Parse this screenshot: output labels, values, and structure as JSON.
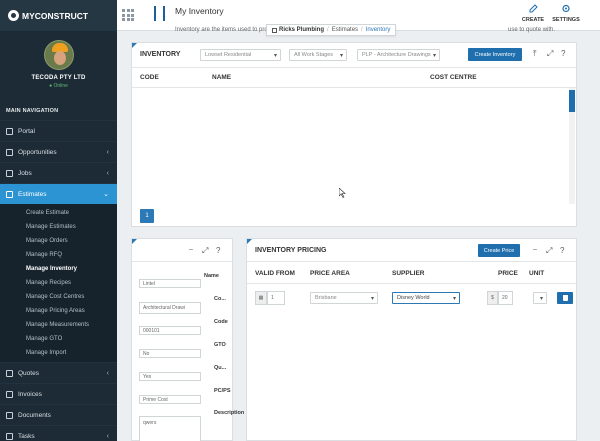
{
  "app": {
    "brand": "MYCONSTRUCT"
  },
  "profile": {
    "company": "TECODA PTY LTD",
    "status": "Online"
  },
  "nav": {
    "heading": "MAIN NAVIGATION",
    "items": [
      {
        "label": "Portal",
        "has_children": false
      },
      {
        "label": "Opportunities",
        "has_children": true
      },
      {
        "label": "Jobs",
        "has_children": true
      },
      {
        "label": "Estimates",
        "has_children": true,
        "active": true
      }
    ],
    "estimates_sub": [
      "Create Estimate",
      "Manage Estimates",
      "Manage Orders",
      "Manage RFQ",
      "Manage Inventory",
      "Manage Recipes",
      "Manage Cost Centres",
      "Manage Pricing Areas",
      "Manage Measurements",
      "Manage GTO",
      "Manage Import"
    ],
    "current_sub": "Manage Inventory",
    "items_after": [
      {
        "label": "Quotes",
        "has_children": true
      },
      {
        "label": "Invoices",
        "has_children": false
      },
      {
        "label": "Documents",
        "has_children": false
      },
      {
        "label": "Tasks",
        "has_children": true
      }
    ]
  },
  "header": {
    "title": "My Inventory",
    "description": "Inventory are the items used to produce your quotes and estimates, th",
    "description_tail": "use to quote with.",
    "breadcrumb": [
      "Ricks Plumbing",
      "Estimates",
      "Inventory"
    ],
    "create_label": "CREATE",
    "settings_label": "SETTINGS"
  },
  "inventory": {
    "title": "INVENTORY",
    "filter_1": "Lowset Residential",
    "filter_2": "All Work Stages",
    "filter_3": "PLP - Architecture Drawings",
    "create_button": "Create Inventory",
    "columns": [
      "CODE",
      "NAME",
      "COST CENTRE"
    ],
    "page": "1"
  },
  "detail": {
    "labels": [
      "Name",
      "Co...",
      "Code",
      "GTO",
      "Qu...",
      "PC/PS",
      "Description"
    ],
    "fields": [
      "Lintel",
      "Architectural Drawi",
      "000101",
      "No",
      "Yes",
      "Prime Cost",
      "qwers"
    ]
  },
  "pricing": {
    "title": "INVENTORY PRICING",
    "create_button": "Create Price",
    "columns": [
      "VALID FROM",
      "PRICE AREA",
      "SUPPLIER",
      "PRICE",
      "UNIT"
    ],
    "row": {
      "valid_from": "1",
      "price_area": "Brisbane",
      "supplier": "Disney World",
      "currency": "$",
      "price": "20"
    }
  },
  "colors": {
    "accent": "#2c79b8",
    "sidebar": "#1d2b36",
    "active_nav": "#2c94d2"
  }
}
